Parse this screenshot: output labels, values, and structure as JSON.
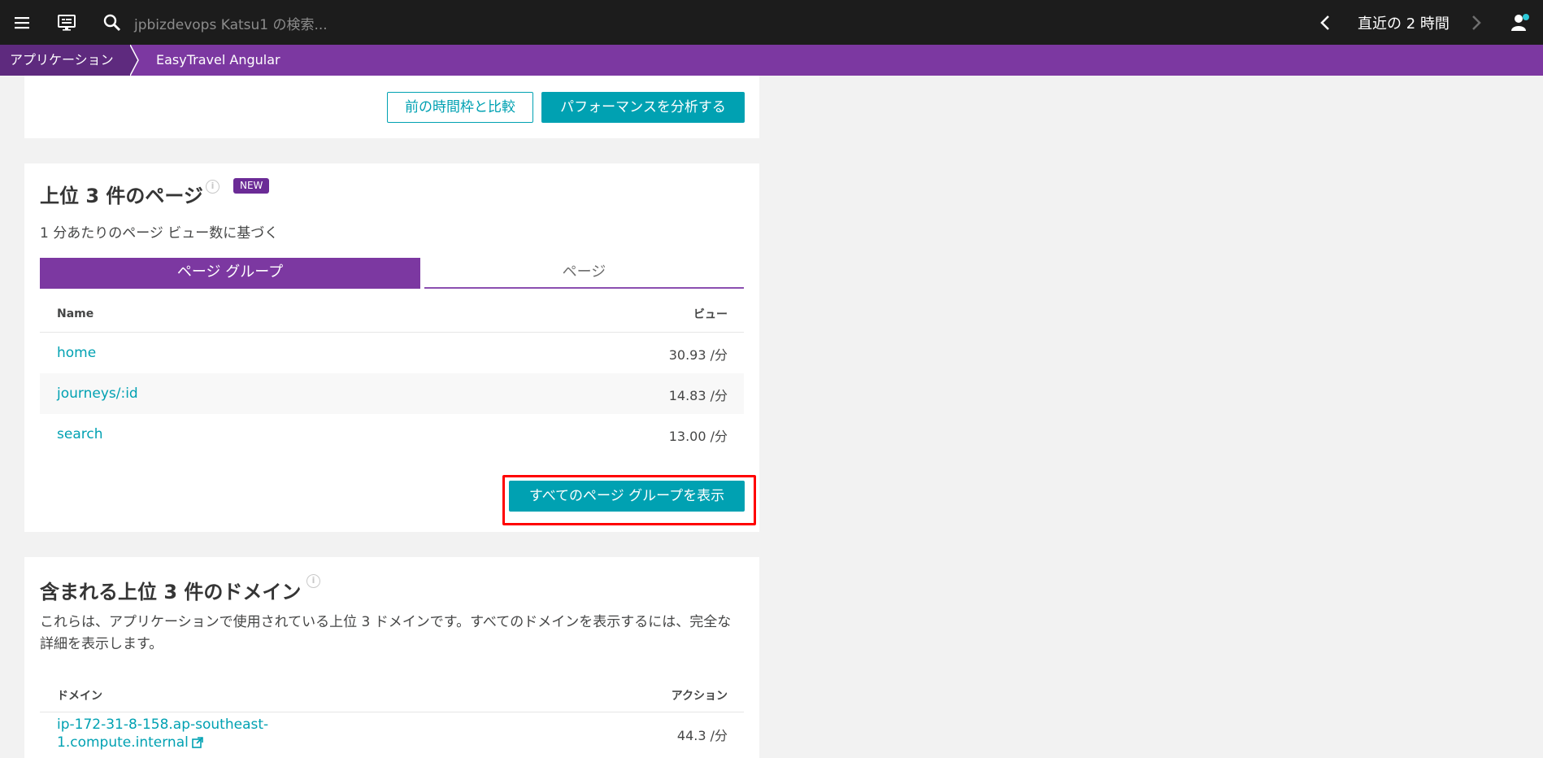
{
  "topbar": {
    "search_placeholder": "jpbizdevops Katsu1 の検索...",
    "time_range": "直近の 2 時間"
  },
  "breadcrumb": {
    "items": [
      "アプリケーション",
      "EasyTravel Angular"
    ]
  },
  "actions_card": {
    "compare_label": "前の時間枠と比較",
    "analyze_label": "パフォーマンスを分析する"
  },
  "top_pages": {
    "title": "上位 3 件のページ",
    "badge": "NEW",
    "subtitle": "1 分あたりのページ ビュー数に基づく",
    "tabs": [
      "ページ グループ",
      "ページ"
    ],
    "columns": [
      "Name",
      "ビュー"
    ],
    "rows": [
      {
        "name": "home",
        "value": "30.93 /分"
      },
      {
        "name": "journeys/:id",
        "value": "14.83 /分"
      },
      {
        "name": "search",
        "value": "13.00 /分"
      }
    ],
    "show_all_label": "すべてのページ グループを表示"
  },
  "top_domains": {
    "title": "含まれる上位 3 件のドメイン",
    "description": "これらは、アプリケーションで使用されている上位 3 ドメインです。すべてのドメインを表示するには、完全な詳細を表示します。",
    "columns": [
      "ドメイン",
      "アクション"
    ],
    "rows": [
      {
        "name_line1": "ip-172-31-8-158.ap-southeast-",
        "name_line2": "1.compute.internal",
        "value": "44.3 /分"
      }
    ]
  },
  "colors": {
    "brand_purple": "#7c38a1",
    "accent_teal": "#00a1b2",
    "highlight_red": "#ff0000"
  }
}
